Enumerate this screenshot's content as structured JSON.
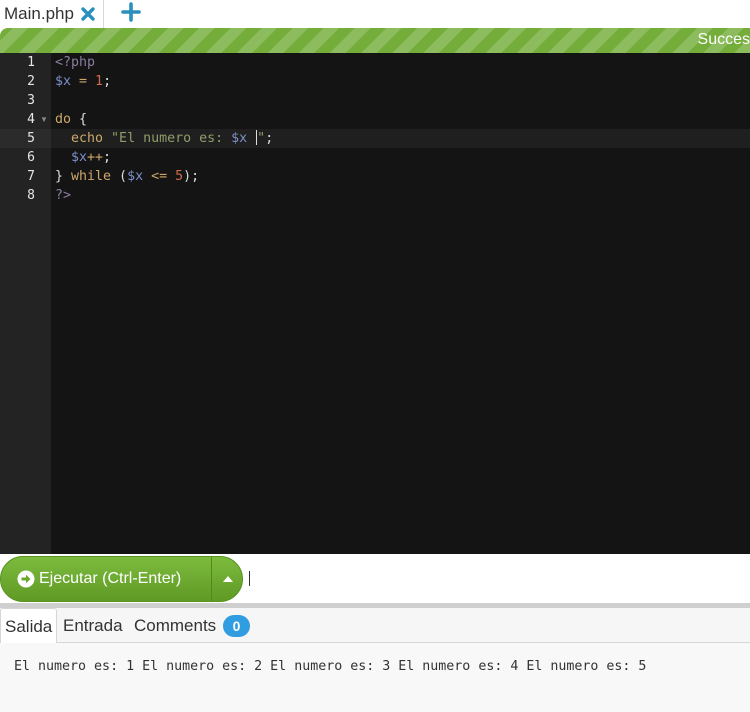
{
  "tabs": {
    "file_label": "Main.php"
  },
  "progress": {
    "status_text": "Succes",
    "fill_percent": 100,
    "color": "#74ad3a"
  },
  "editor": {
    "line_numbers": [
      "1",
      "2",
      "3",
      "4",
      "5",
      "6",
      "7",
      "8"
    ],
    "lines": [
      [
        {
          "t": "<?php",
          "c": "meta"
        }
      ],
      [
        {
          "t": "$x",
          "c": "var"
        },
        {
          "t": " = ",
          "c": "op"
        },
        {
          "t": "1",
          "c": "num"
        },
        {
          "t": ";",
          "c": "plain"
        }
      ],
      [],
      [
        {
          "t": "do",
          "c": "kw"
        },
        {
          "t": " {",
          "c": "plain"
        }
      ],
      [
        {
          "t": "  ",
          "c": "plain"
        },
        {
          "t": "echo",
          "c": "kw"
        },
        {
          "t": " \"El numero es: ",
          "c": "str"
        },
        {
          "t": "$x",
          "c": "var"
        },
        {
          "t": " ",
          "c": "str"
        },
        {
          "t": "\"",
          "c": "str"
        },
        {
          "t": ";",
          "c": "plain"
        }
      ],
      [
        {
          "t": "  ",
          "c": "plain"
        },
        {
          "t": "$x",
          "c": "var"
        },
        {
          "t": "++",
          "c": "op"
        },
        {
          "t": ";",
          "c": "plain"
        }
      ],
      [
        {
          "t": "} ",
          "c": "plain"
        },
        {
          "t": "while",
          "c": "kw"
        },
        {
          "t": " (",
          "c": "plain"
        },
        {
          "t": "$x",
          "c": "var"
        },
        {
          "t": " <= ",
          "c": "op"
        },
        {
          "t": "5",
          "c": "num"
        },
        {
          "t": ");",
          "c": "plain"
        }
      ],
      [
        {
          "t": "?>",
          "c": "meta"
        }
      ]
    ],
    "active_line": 5,
    "fold_line": 4
  },
  "run": {
    "button_label": "Ejecutar (Ctrl-Enter)"
  },
  "output_tabs": {
    "salida": "Salida",
    "entrada": "Entrada",
    "comments": "Comments",
    "comments_count": "0"
  },
  "output": {
    "text": "El numero es: 1 El numero es: 2 El numero es: 3 El numero es: 4 El numero es: 5"
  },
  "icons": {
    "close": "close-icon",
    "add": "plus-icon",
    "run": "arrow-circle-icon",
    "dropdown": "caret-up-icon"
  }
}
